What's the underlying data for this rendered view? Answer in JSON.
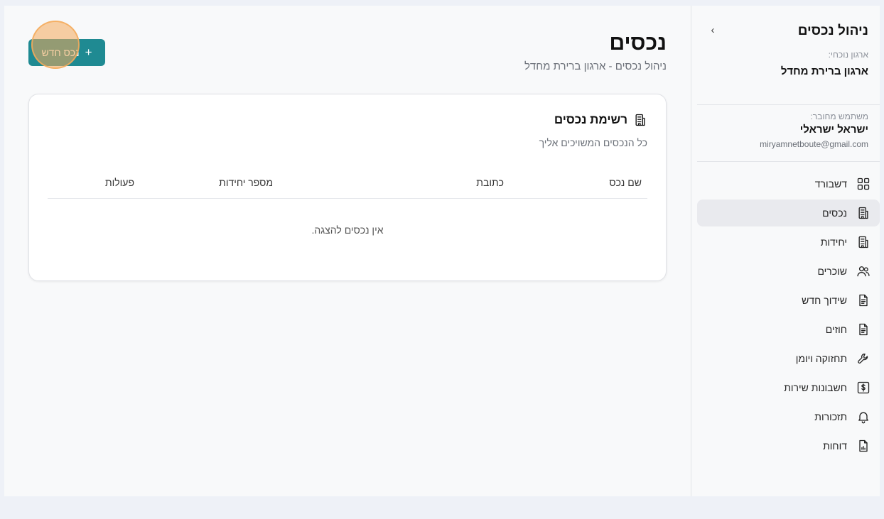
{
  "sidebar": {
    "title": "ניהול נכסים",
    "collapse_icon": "chevron-right-icon",
    "org_label": "ארגון נוכחי:",
    "org_name": "ארגון ברירת מחדל",
    "user_label": "משתמש מחובר:",
    "user_name": "ישראל ישראלי",
    "user_email": "miryamnetboute@gmail.com",
    "items": [
      {
        "label": "דשבורד",
        "icon": "dashboard-icon",
        "active": false
      },
      {
        "label": "נכסים",
        "icon": "building-icon",
        "active": true
      },
      {
        "label": "יחידות",
        "icon": "building-icon",
        "active": false
      },
      {
        "label": "שוכרים",
        "icon": "users-icon",
        "active": false
      },
      {
        "label": "שידוך חדש",
        "icon": "document-icon",
        "active": false
      },
      {
        "label": "חוזים",
        "icon": "document-icon",
        "active": false
      },
      {
        "label": "תחזוקה ויומן",
        "icon": "wrench-icon",
        "active": false
      },
      {
        "label": "חשבונות שירות",
        "icon": "dollar-icon",
        "active": false
      },
      {
        "label": "תזכורות",
        "icon": "bell-icon",
        "active": false
      },
      {
        "label": "דוחות",
        "icon": "report-icon",
        "active": false
      }
    ]
  },
  "header": {
    "title": "נכסים",
    "subtitle": "ניהול נכסים - ארגון ברירת מחדל",
    "add_button_label": "נכס חדש",
    "add_button_icon": "plus-icon"
  },
  "card": {
    "title": "רשימת נכסים",
    "subtitle": "כל הנכסים המשויכים אליך",
    "columns": [
      "שם נכס",
      "כתובת",
      "מספר יחידות",
      "פעולות"
    ],
    "empty_message": "אין נכסים להצגה."
  },
  "colors": {
    "accent": "#1f8a92",
    "click_highlight": "#f4aa5a"
  }
}
